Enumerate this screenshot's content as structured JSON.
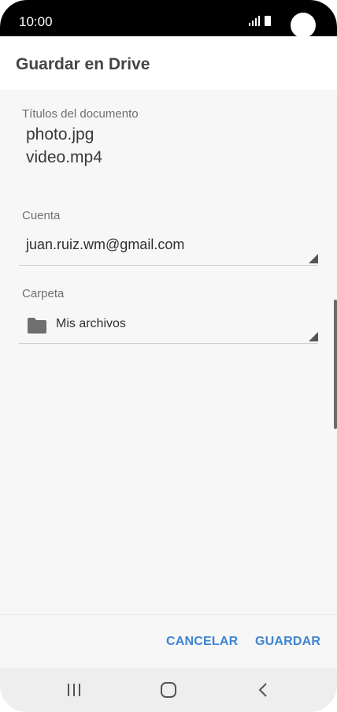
{
  "status_bar": {
    "time": "10:00"
  },
  "header": {
    "title": "Guardar en Drive"
  },
  "document_titles": {
    "label": "Títulos del documento",
    "items": [
      "photo.jpg",
      "video.mp4"
    ]
  },
  "account": {
    "label": "Cuenta",
    "value": "juan.ruiz.wm@gmail.com"
  },
  "folder": {
    "label": "Carpeta",
    "value": "Mis archivos",
    "icon": "folder-icon"
  },
  "actions": {
    "cancel_label": "CANCELAR",
    "save_label": "GUARDAR",
    "accent_color": "#3f84d2"
  },
  "nav": {
    "recent_icon": "recent-apps-icon",
    "home_icon": "home-icon",
    "back_icon": "back-icon"
  }
}
